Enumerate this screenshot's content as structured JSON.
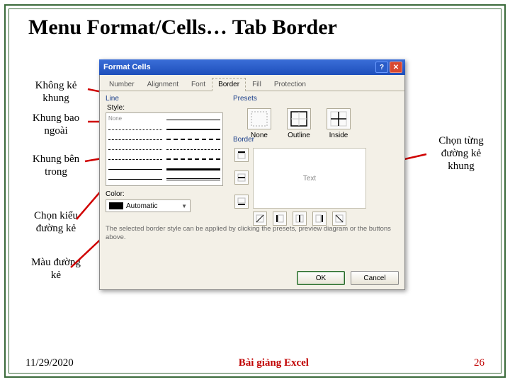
{
  "title": "Menu Format/Cells… Tab Border",
  "callouts": {
    "none": "Không kẻ khung",
    "outline": "Khung bao ngoài",
    "inside": "Khung bên trong",
    "style": "Chọn kiểu đường kẻ",
    "colorLabel": "Màu đường kẻ",
    "border": "Chọn từng đường kẻ khung"
  },
  "dialog": {
    "title": "Format Cells",
    "tabs": [
      "Number",
      "Alignment",
      "Font",
      "Border",
      "Fill",
      "Protection"
    ],
    "activeTab": "Border",
    "line": {
      "label": "Line",
      "styleLabel": "Style:",
      "noneLabel": "None"
    },
    "color": {
      "label": "Color:",
      "value": "Automatic"
    },
    "presets": {
      "label": "Presets",
      "none": "None",
      "outline": "Outline",
      "inside": "Inside"
    },
    "border": {
      "label": "Border",
      "previewText": "Text"
    },
    "hint": "The selected border style can be applied by clicking the presets, preview diagram or the buttons above.",
    "ok": "OK",
    "cancel": "Cancel"
  },
  "footer": {
    "date": "11/29/2020",
    "center": "Bài giảng Excel",
    "page": "26"
  }
}
